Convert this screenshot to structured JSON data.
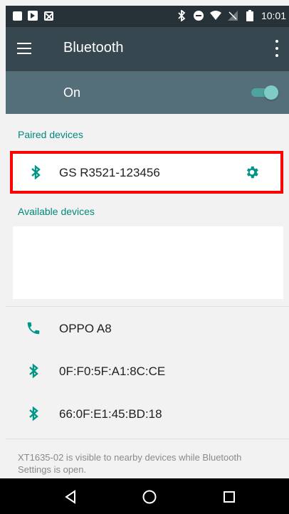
{
  "status_bar": {
    "time": "10:01",
    "icons_left": [
      "image-icon",
      "app-icon",
      "no-sim-icon"
    ],
    "icons_right": [
      "bluetooth-icon",
      "do-not-disturb-icon",
      "wifi-icon",
      "no-signal-icon",
      "battery-icon"
    ]
  },
  "app_bar": {
    "title": "Bluetooth",
    "menu_icon": "hamburger-icon",
    "overflow_icon": "more-vert-icon"
  },
  "toggle_bar": {
    "label": "On",
    "state": "on"
  },
  "sections": {
    "paired_header": "Paired devices",
    "available_header": "Available devices"
  },
  "paired_devices": [
    {
      "name": "GS R3521-123456",
      "icon": "bluetooth-icon",
      "action_icon": "gear-icon"
    }
  ],
  "available_devices": [
    {
      "name": "OPPO A8",
      "icon": "phone-icon"
    },
    {
      "name": "0F:F0:5F:A1:8C:CE",
      "icon": "bluetooth-icon"
    },
    {
      "name": "66:0F:E1:45:BD:18",
      "icon": "bluetooth-icon"
    }
  ],
  "footer": "XT1635-02 is visible to nearby devices while Bluetooth Settings is open.",
  "nav_bar": {
    "back_icon": "back-icon",
    "home_icon": "home-icon",
    "recents_icon": "recents-icon"
  },
  "colors": {
    "accent": "#009688",
    "app_bar": "#37474f",
    "toggle_bar": "#546e7a",
    "highlight_box": "#ff0000"
  }
}
